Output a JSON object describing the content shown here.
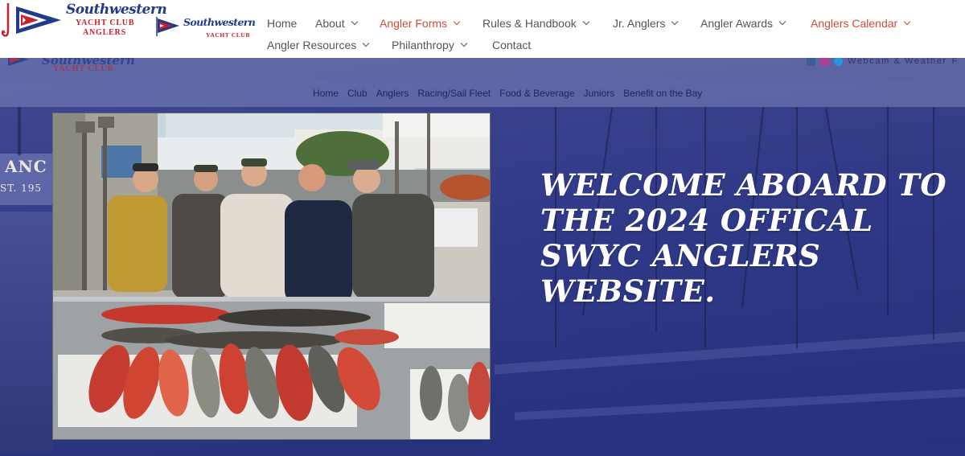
{
  "header": {
    "logo_primary": {
      "name": "Southwestern",
      "line2": "YACHT CLUB",
      "line3": "ANGLERS"
    },
    "logo_secondary": {
      "name": "Southwestern",
      "line2": "YACHT CLUB"
    },
    "nav": [
      {
        "label": "Home",
        "dropdown": false,
        "highlight": false
      },
      {
        "label": "About",
        "dropdown": true,
        "highlight": false
      },
      {
        "label": "Angler Forms",
        "dropdown": true,
        "highlight": true
      },
      {
        "label": "Rules & Handbook",
        "dropdown": true,
        "highlight": false
      },
      {
        "label": "Jr. Anglers",
        "dropdown": true,
        "highlight": false
      },
      {
        "label": "Angler Awards",
        "dropdown": true,
        "highlight": false
      },
      {
        "label": "Anglers Calendar",
        "dropdown": true,
        "highlight": true
      },
      {
        "label": "Angler Resources",
        "dropdown": true,
        "highlight": false
      },
      {
        "label": "Philanthropy",
        "dropdown": true,
        "highlight": false
      },
      {
        "label": "Contact",
        "dropdown": false,
        "highlight": false
      }
    ]
  },
  "background_site": {
    "logo_name": "Southwestern",
    "logo_line2": "YACHT CLUB",
    "webcam_text": "Webcam & Weather",
    "webcam_suffix": "F",
    "sign_text": "ANC",
    "sign_text2": "ST. 195",
    "subnav": [
      "Home",
      "Club",
      "Anglers",
      "Racing/Sail Fleet",
      "Food & Beverage",
      "Juniors",
      "Benefit on the Bay"
    ]
  },
  "hero": {
    "welcome_text": "Welcome aboard to the 2024 offical SWYC Anglers website."
  },
  "colors": {
    "accent_red": "#d14a3c",
    "nav_text": "#555555",
    "brand_blue": "#1f3b8a",
    "hero_overlay": "#2d357a"
  }
}
